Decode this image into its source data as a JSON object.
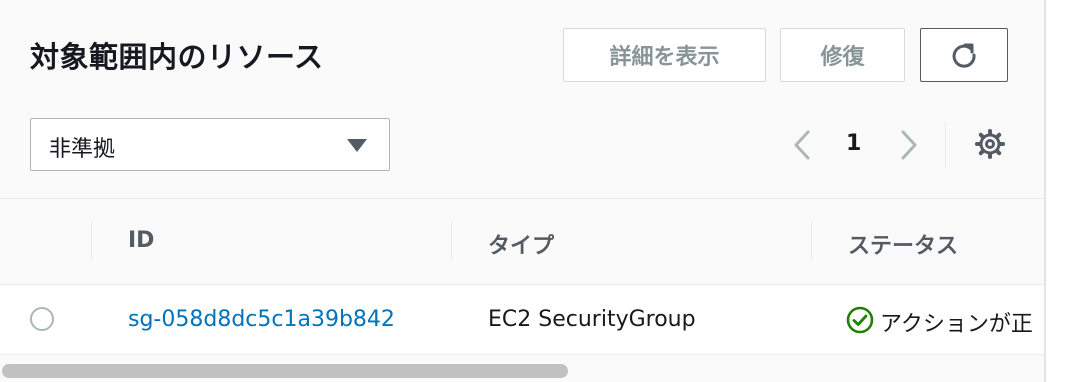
{
  "header": {
    "title": "対象範囲内のリソース",
    "buttons": {
      "details_label": "詳細を表示",
      "remediate_label": "修復",
      "refresh_icon": "refresh-icon"
    }
  },
  "filter": {
    "selected": "非準拠"
  },
  "pagination": {
    "current_page": "1",
    "prev_icon": "chevron-left-icon",
    "next_icon": "chevron-right-icon",
    "settings_icon": "gear-icon"
  },
  "table": {
    "columns": [
      "ID",
      "タイプ",
      "ステータス"
    ],
    "rows": [
      {
        "id": "sg-058d8dc5c1a39b842",
        "type": "EC2 SecurityGroup",
        "status": "アクションが正",
        "status_icon": "check-circle-icon"
      }
    ]
  },
  "colors": {
    "link": "#0073bb",
    "success": "#1d8102"
  }
}
